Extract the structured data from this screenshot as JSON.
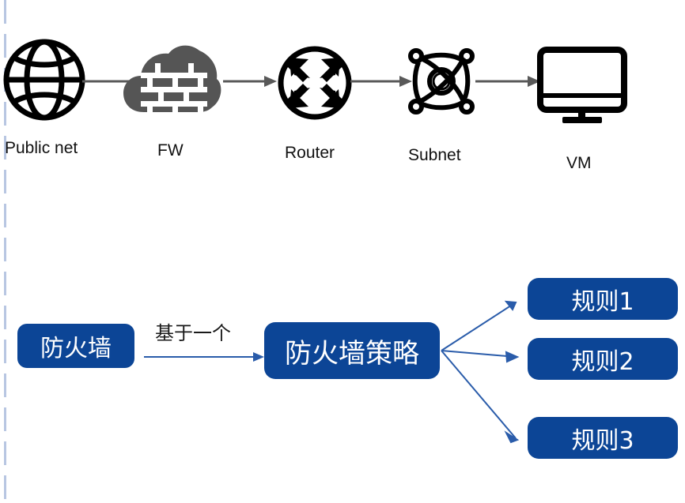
{
  "diagram": {
    "title": "Firewall network topology and firewall policy rules",
    "colors": {
      "box_blue": "#0c4596",
      "arrow_blue": "#2a5caa",
      "arrow_gray": "#595959",
      "icon_black": "#000000",
      "icon_cloud_gray": "#555555",
      "margin_dash": "#b8c6e2",
      "text_dark": "#111111",
      "box_text": "#ffffff"
    },
    "topology": {
      "nodes": [
        {
          "id": "public-net",
          "label": "Public net",
          "icon": "globe-icon"
        },
        {
          "id": "firewall",
          "label": "FW",
          "icon": "cloud-firewall-icon"
        },
        {
          "id": "router",
          "label": "Router",
          "icon": "router-icon"
        },
        {
          "id": "subnet",
          "label": "Subnet",
          "icon": "subnet-atom-icon"
        },
        {
          "id": "vm",
          "label": "VM",
          "icon": "monitor-icon"
        }
      ],
      "connections": [
        {
          "from": "public-net",
          "to": "firewall",
          "arrow": "arrow-right-icon"
        },
        {
          "from": "firewall",
          "to": "router",
          "arrow": "arrow-right-icon"
        },
        {
          "from": "router",
          "to": "subnet",
          "arrow": "arrow-right-icon"
        },
        {
          "from": "subnet",
          "to": "vm",
          "arrow": "arrow-right-icon"
        }
      ]
    },
    "policy": {
      "source_box": {
        "id": "firewall-box",
        "label": "防火墙"
      },
      "edge_label": "基于一个",
      "edge_arrow": "arrow-right-icon",
      "policy_box": {
        "id": "firewall-policy-box",
        "label": "防火墙策略"
      },
      "rules": [
        {
          "id": "rule-1",
          "label": "规则1"
        },
        {
          "id": "rule-2",
          "label": "规则2"
        },
        {
          "id": "rule-3",
          "label": "规则3"
        }
      ]
    }
  }
}
